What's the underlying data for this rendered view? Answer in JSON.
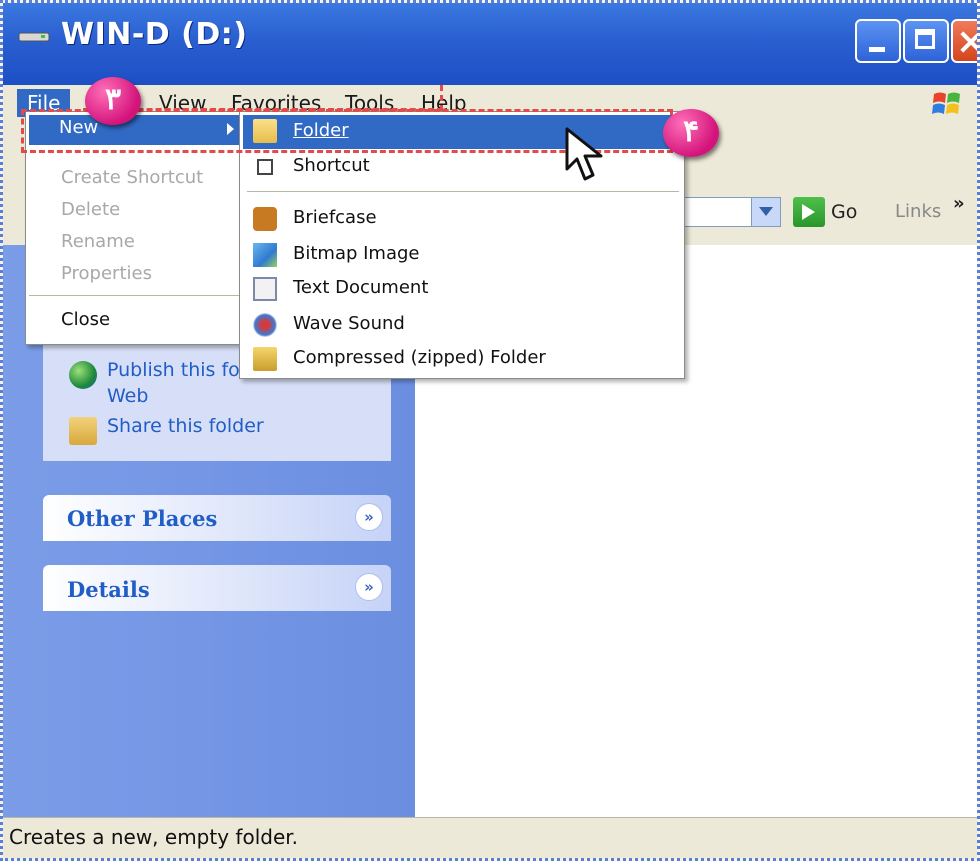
{
  "window": {
    "title": "WIN-D (D:)"
  },
  "menubar": {
    "file": "File",
    "view": "View",
    "favorites": "Favorites",
    "tools": "Tools",
    "help": "Help"
  },
  "badges": {
    "step3": "۳",
    "step4": "۴"
  },
  "file_menu": {
    "new": "New",
    "create_shortcut": "Create Shortcut",
    "delete": "Delete",
    "rename": "Rename",
    "properties": "Properties",
    "close": "Close"
  },
  "new_submenu": {
    "folder": "Folder",
    "shortcut": "Shortcut",
    "briefcase": "Briefcase",
    "bitmap": "Bitmap Image",
    "text_document": "Text Document",
    "wave_sound": "Wave Sound",
    "compressed": "Compressed (zipped) Folder"
  },
  "address": {
    "go": "Go",
    "links": "Links",
    "more": "»"
  },
  "tasks": {
    "publish": "Publish this fo",
    "publish_cont": "Web",
    "share": "Share this folder"
  },
  "sections": {
    "other_places": "Other Places",
    "details": "Details"
  },
  "status": {
    "text": "Creates a new, empty folder."
  },
  "colors": {
    "title_blue": "#2a5fd0",
    "highlight": "#316ac5",
    "dash_red": "#e34b4b",
    "badge_pink": "#d3127a",
    "link_blue": "#215dc6"
  }
}
